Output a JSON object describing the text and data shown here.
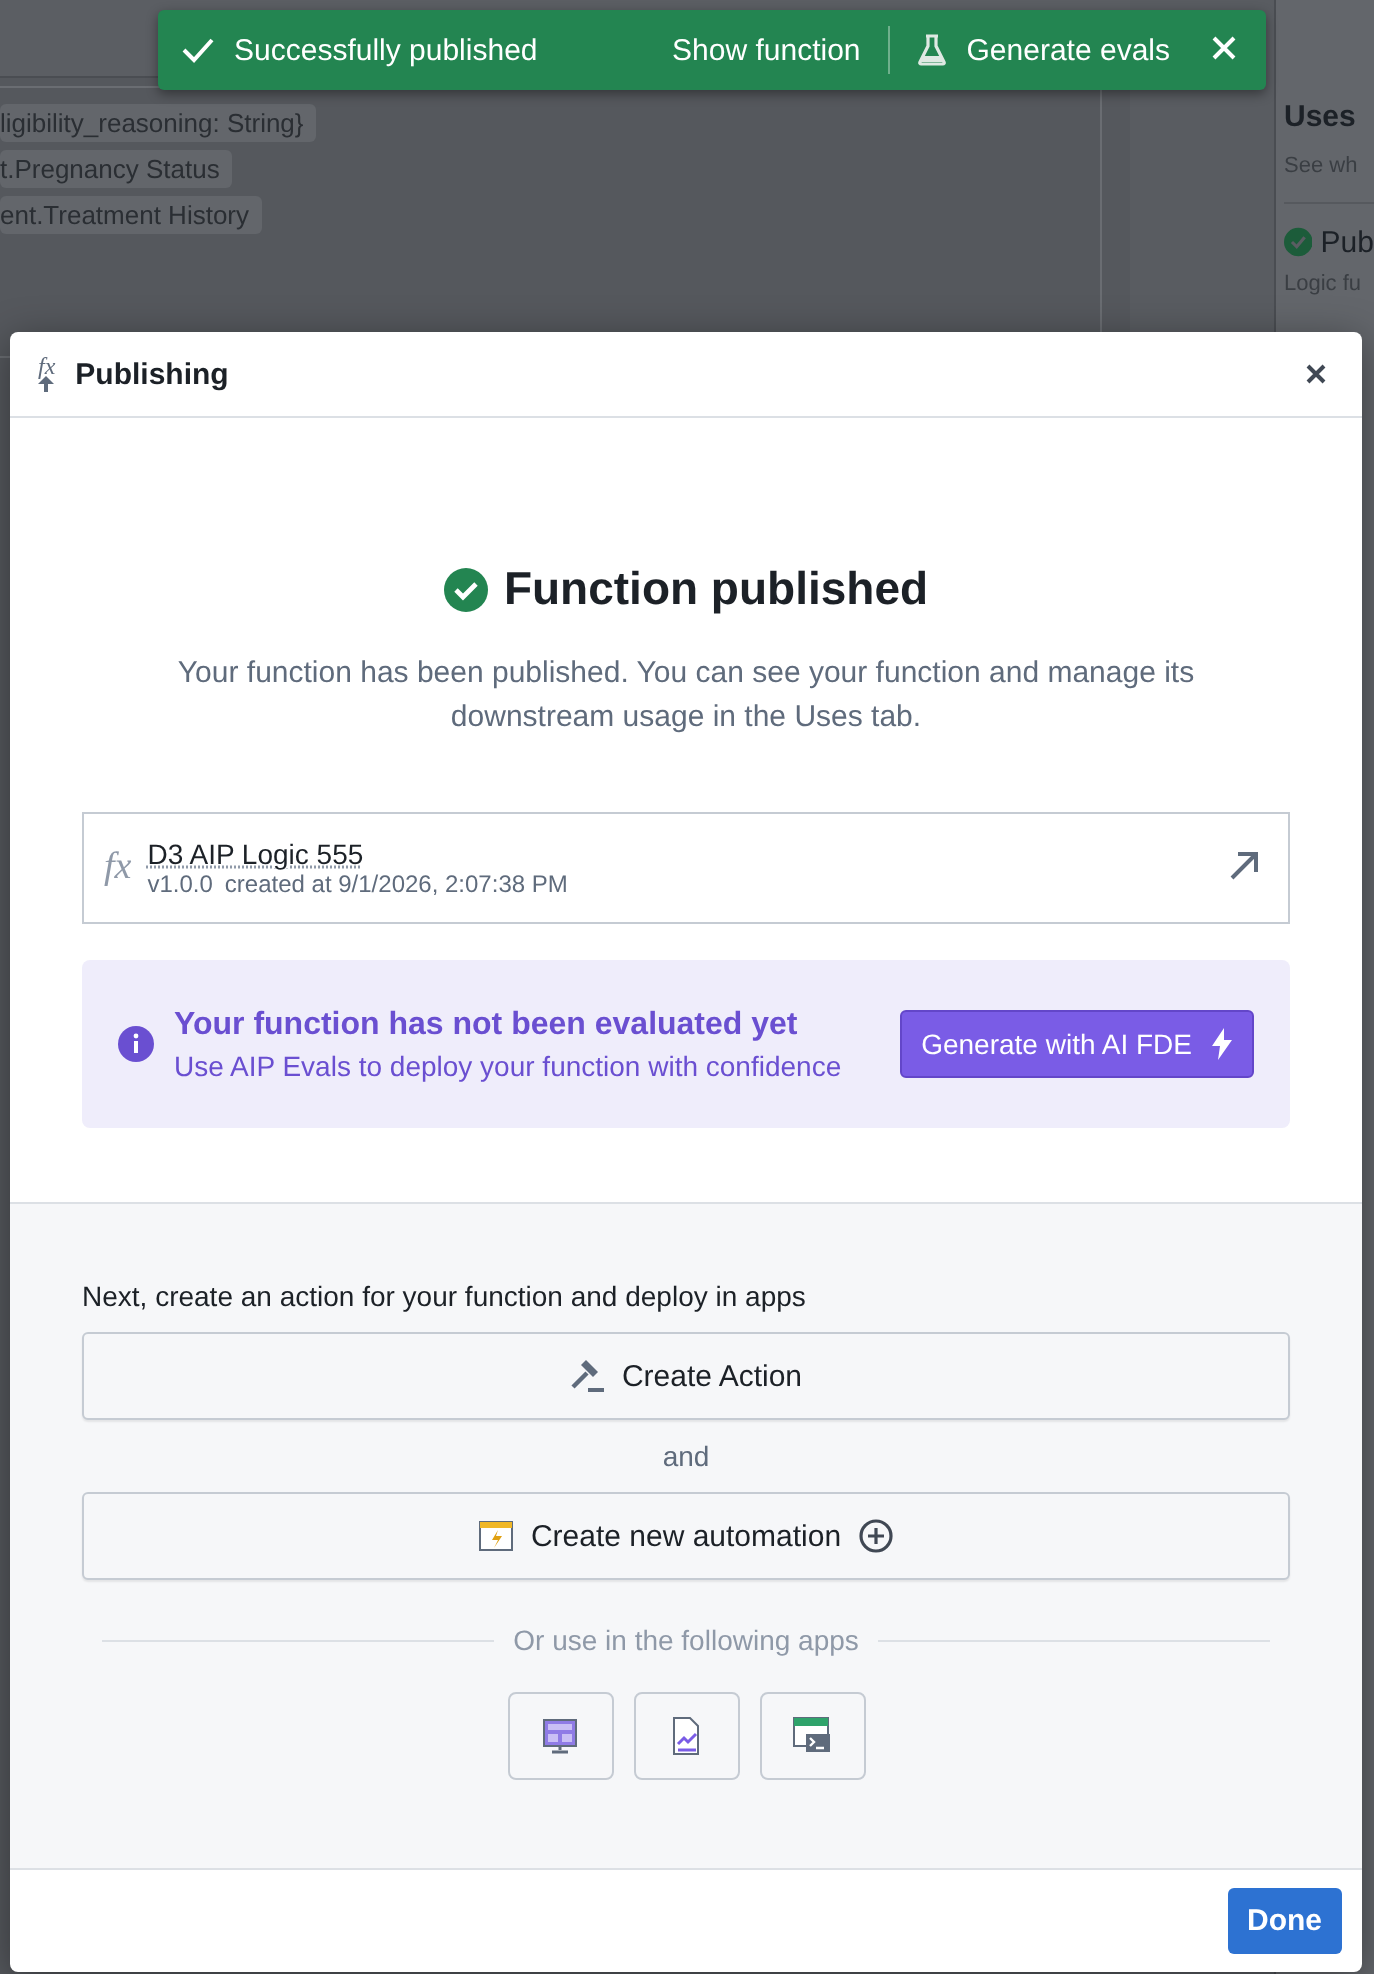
{
  "background": {
    "chips": [
      "ligibility_reasoning: String}",
      "t.Pregnancy Status",
      "ent.Treatment History"
    ],
    "side_panel": {
      "title": "Uses",
      "subtitle": "See wh",
      "status": "Pub",
      "note": "Logic fu"
    }
  },
  "toast": {
    "message": "Successfully published",
    "actions": [
      {
        "label": "Show function",
        "kind": "link"
      },
      {
        "label": "Generate evals",
        "kind": "flask"
      }
    ]
  },
  "dialog": {
    "title_icon": "fx",
    "title": "Publishing",
    "heading": "Function published",
    "description": "Your function has been published. You can see your function and manage its downstream usage in the Uses tab.",
    "function": {
      "icon": "fx",
      "name": "D3 AIP Logic 555",
      "version": "v1.0.0",
      "created": "created at 9/1/2026, 2:07:38 PM"
    },
    "eval_callout": {
      "title": "Your function has not been evaluated yet",
      "text": "Use AIP Evals to deploy your function with confidence",
      "button": "Generate with AI FDE"
    },
    "next_label": "Next, create an action for your function and deploy in apps",
    "actions": [
      {
        "label": "Create Action",
        "kind": "action"
      },
      {
        "label": "Create new automation",
        "kind": "automation"
      }
    ],
    "separator": "and",
    "apps_label": "Or use in the following apps",
    "apps": [
      {
        "kind": "dashboard"
      },
      {
        "kind": "chart"
      },
      {
        "kind": "console"
      }
    ],
    "done": "Done"
  }
}
